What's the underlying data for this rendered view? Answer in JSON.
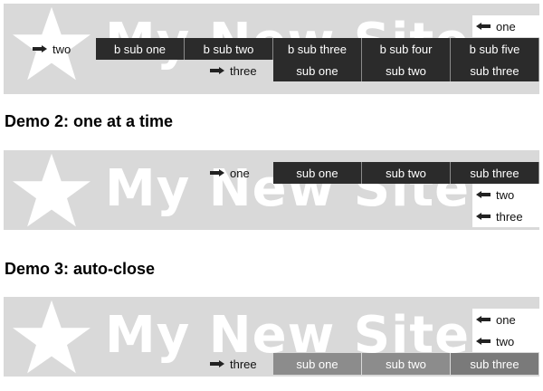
{
  "brand": {
    "site_title": "My New Site"
  },
  "demo1": {
    "top_items": [
      "b sub one",
      "b sub two",
      "b sub three",
      "b sub four",
      "b sub five"
    ],
    "sub_items": [
      "sub one",
      "sub two",
      "sub three"
    ],
    "labels": {
      "one": "one",
      "two": "two",
      "three": "three"
    }
  },
  "demo2": {
    "title": "Demo 2: one at a time",
    "sub_items": [
      "sub one",
      "sub two",
      "sub three"
    ],
    "labels": {
      "one": "one",
      "two": "two",
      "three": "three"
    }
  },
  "demo3": {
    "title": "Demo 3: auto-close",
    "sub_items": [
      "sub one",
      "sub two",
      "sub three"
    ],
    "labels": {
      "one": "one",
      "two": "two",
      "three": "three"
    }
  },
  "icons": [
    "star-logo-icon",
    "arrow-right-icon",
    "arrow-left-icon"
  ],
  "colors": {
    "banner": "#d9d9d9",
    "menu_dark": "#2b2b2b",
    "menu_faded": "#8c8c8c"
  }
}
